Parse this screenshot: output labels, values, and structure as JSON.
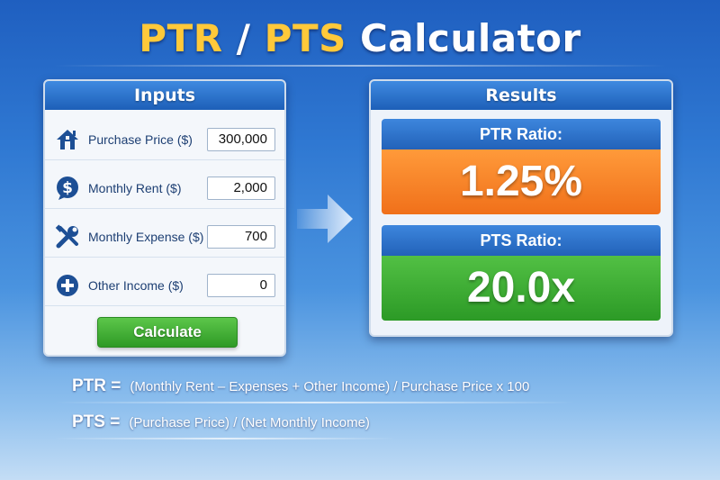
{
  "title": {
    "part1": "PTR",
    "separator": " / ",
    "part2": "PTS",
    "part3": " Calculator"
  },
  "colors": {
    "accent_yellow": "#ffc93a",
    "header_blue": "#2262b9",
    "ptr_orange": "#f0701a",
    "pts_green": "#2c9a26",
    "button_green": "#2f9a26"
  },
  "inputs": {
    "header": "Inputs",
    "fields": [
      {
        "icon": "house-icon",
        "label": "Purchase Price ($)",
        "value": "300,000"
      },
      {
        "icon": "dollar-bubble-icon",
        "label": "Monthly Rent ($)",
        "value": "2,000"
      },
      {
        "icon": "tools-icon",
        "label": "Monthly Expense ($)",
        "value": "700"
      },
      {
        "icon": "plus-circle-icon",
        "label": "Other Income ($)",
        "value": "0"
      }
    ],
    "button_label": "Calculate"
  },
  "results": {
    "header": "Results",
    "ptr": {
      "label": "PTR Ratio:",
      "value": "1.25%"
    },
    "pts": {
      "label": "PTS Ratio:",
      "value": "20.0x"
    }
  },
  "formulas": {
    "ptr": {
      "lhs": "PTR =",
      "rhs": "(Monthly Rent – Expenses + Other Income)  /  Purchase Price x 100"
    },
    "pts": {
      "lhs": "PTS =",
      "rhs": "(Purchase Price)  /  (Net Monthly Income)"
    }
  }
}
